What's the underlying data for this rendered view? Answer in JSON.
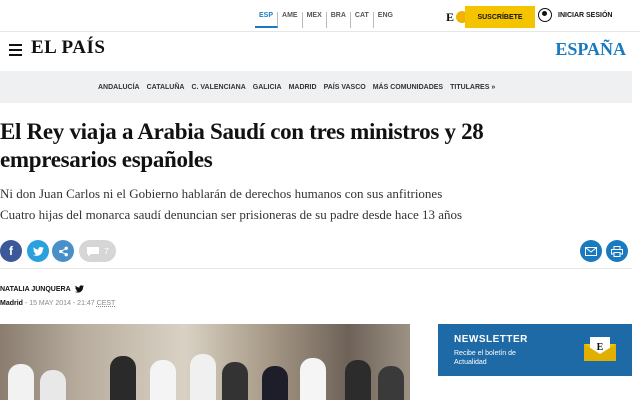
{
  "top": {
    "editions": [
      "ESP",
      "AME",
      "MEX",
      "BRA",
      "CAT",
      "ENG"
    ],
    "active_edition": "ESP",
    "e_logo": "E",
    "subscribe": "SUSCRÍBETE",
    "login": "INICIAR SESIÓN"
  },
  "masthead": {
    "brand": "EL PAÍS",
    "section": "ESPAÑA"
  },
  "regions": [
    "ANDALUCÍA",
    "CATALUÑA",
    "C. VALENCIANA",
    "GALICIA",
    "MADRID",
    "PAÍS VASCO",
    "MÁS COMUNIDADES",
    "TITULARES »"
  ],
  "article": {
    "headline_line1": "El Rey viaja a Arabia Saudí con tres ministros y 28",
    "headline_line2": "empresarios españoles",
    "subtitle1": "Ni don Juan Carlos ni el Gobierno hablarán de derechos humanos con sus anfitriones",
    "subtitle2": "Cuatro hijas del monarca saudí denuncian ser prisioneras de su padre desde hace 13 años",
    "comments_count": "7",
    "author": "NATALIA JUNQUERA",
    "place": "Madrid",
    "date": "15 MAY 2014 - 21:47",
    "tz": "CEST"
  },
  "newsletter": {
    "title": "NEWSLETTER",
    "text": "Recibe el boletín de Actualidad"
  },
  "colors": {
    "accent": "#1a7ac0",
    "subscribe": "#f5c400",
    "facebook": "#3b5998",
    "twitter": "#2aa1de",
    "newsletter_bg": "#1e6aa6"
  }
}
